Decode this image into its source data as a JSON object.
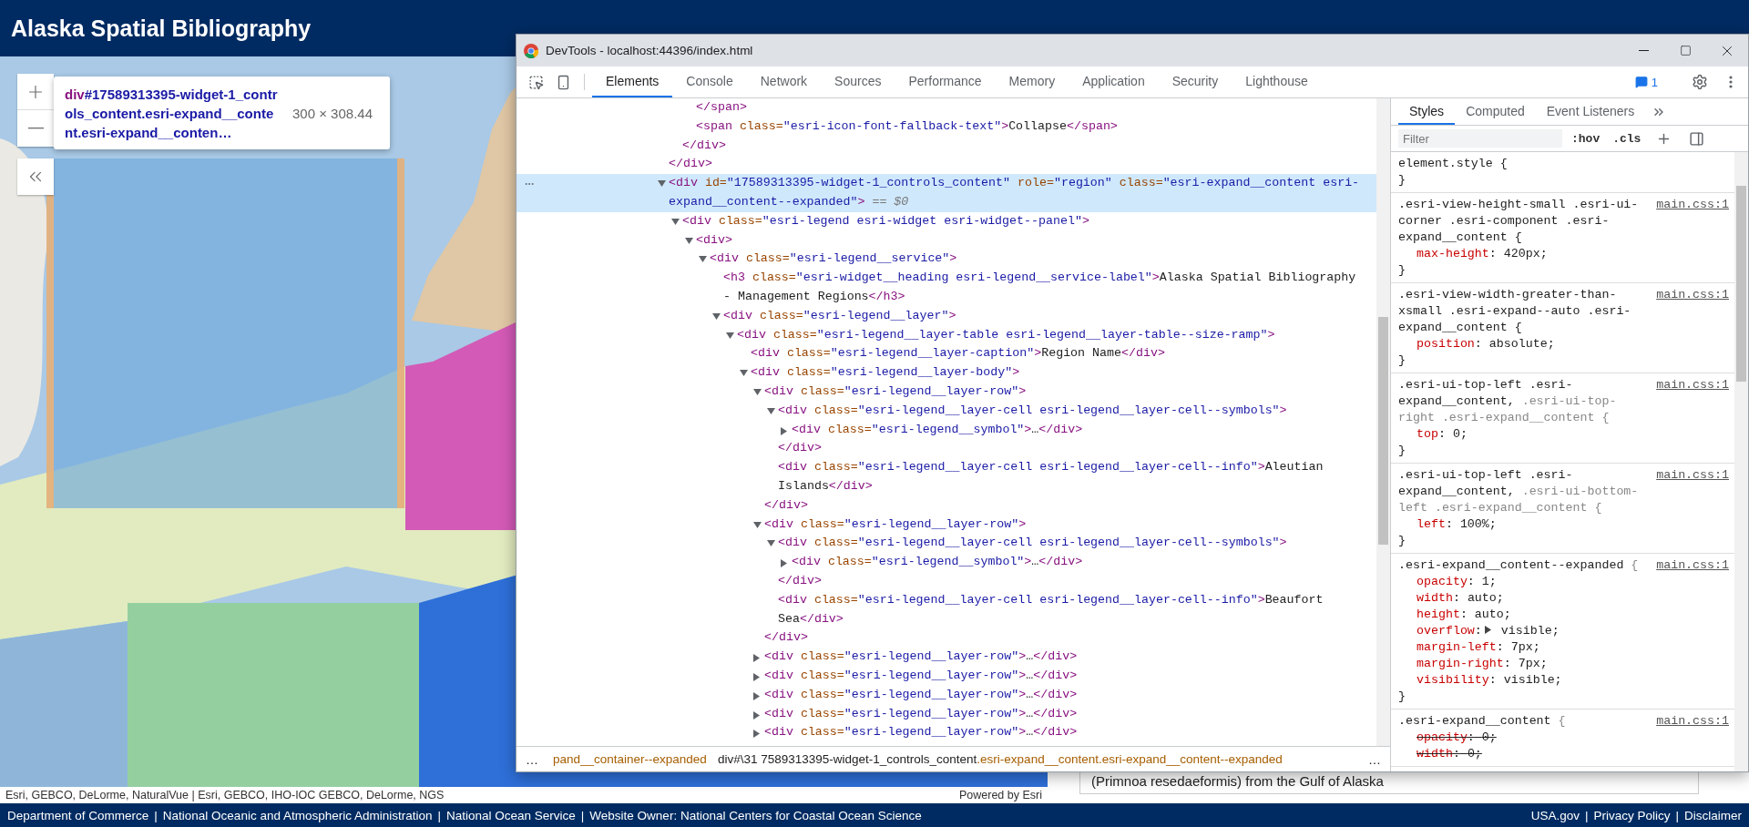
{
  "header": {
    "title": "Alaska Spatial Bibliography"
  },
  "map": {
    "inspect_tooltip": {
      "tag": "div",
      "selector": "#17589313395-widget-1_controls_content.esri-expand__content.esri-expand__conten…",
      "size": "300 × 308.44"
    },
    "attribution": "Esri, GEBCO, DeLorme, NaturalVue | Esri, GEBCO, IHO-IOC GEBCO, DeLorme, NGS",
    "powered_by": "Powered by Esri"
  },
  "sidebar": {
    "result_text": "(Primnoa resedaeformis) from the Gulf of Alaska"
  },
  "devtools": {
    "title": "DevTools - localhost:44396/index.html",
    "tabs": [
      {
        "label": "Elements",
        "selected": true
      },
      {
        "label": "Console",
        "selected": false
      },
      {
        "label": "Network",
        "selected": false
      },
      {
        "label": "Sources",
        "selected": false
      },
      {
        "label": "Performance",
        "selected": false
      },
      {
        "label": "Memory",
        "selected": false
      },
      {
        "label": "Application",
        "selected": false
      },
      {
        "label": "Security",
        "selected": false
      },
      {
        "label": "Lighthouse",
        "selected": false
      }
    ],
    "issues_count": "1",
    "elements": {
      "tree": [
        {
          "close": [
            {
              "kind": "tag",
              "text": "</div>"
            }
          ],
          "children": [
            {
              "close": [
                {
                  "kind": "tag",
                  "text": "</div>"
                }
              ],
              "children": [
                {
                  "kind": "plain",
                  "selected": false,
                  "tokens": [
                    {
                      "kind": "tag",
                      "text": "</span>"
                    }
                  ]
                },
                {
                  "kind": "plain",
                  "selected": false,
                  "tokens": [
                    {
                      "kind": "tag",
                      "text": "<span"
                    },
                    {
                      "kind": "attr",
                      "text": " class="
                    },
                    {
                      "kind": "value",
                      "text": "\"esri-icon-font-fallback-text\""
                    },
                    {
                      "kind": "tag",
                      "text": ">"
                    },
                    {
                      "kind": "text",
                      "text": "Collapse"
                    },
                    {
                      "kind": "tag",
                      "text": "</span>"
                    }
                  ]
                }
              ]
            }
          ]
        },
        {
          "kind": "expanded",
          "selected": true,
          "tokens": [
            {
              "kind": "tag",
              "text": "<div"
            },
            {
              "kind": "attr",
              "text": " id="
            },
            {
              "kind": "value",
              "text": "\"17589313395-widget-1_controls_content\""
            },
            {
              "kind": "attr",
              "text": " role="
            },
            {
              "kind": "value",
              "text": "\"region\""
            },
            {
              "kind": "attr",
              "text": " class="
            },
            {
              "kind": "value",
              "text": "\"esri-expand__content esri-expand__content--expanded\""
            },
            {
              "kind": "tag",
              "text": ">"
            },
            {
              "kind": "note",
              "text": " == $0"
            }
          ],
          "children": [
            {
              "kind": "expanded",
              "selected": false,
              "tokens": [
                {
                  "kind": "tag",
                  "text": "<div"
                },
                {
                  "kind": "attr",
                  "text": " class="
                },
                {
                  "kind": "value",
                  "text": "\"esri-legend esri-widget esri-widget--panel\""
                },
                {
                  "kind": "tag",
                  "text": ">"
                }
              ],
              "children": [
                {
                  "kind": "expanded",
                  "selected": false,
                  "tokens": [
                    {
                      "kind": "tag",
                      "text": "<div>"
                    }
                  ],
                  "children": [
                    {
                      "kind": "expanded",
                      "selected": false,
                      "tokens": [
                        {
                          "kind": "tag",
                          "text": "<div"
                        },
                        {
                          "kind": "attr",
                          "text": " class="
                        },
                        {
                          "kind": "value",
                          "text": "\"esri-legend__service\""
                        },
                        {
                          "kind": "tag",
                          "text": ">"
                        }
                      ],
                      "children": [
                        {
                          "kind": "plain",
                          "selected": false,
                          "tokens": [
                            {
                              "kind": "tag",
                              "text": "<h3"
                            },
                            {
                              "kind": "attr",
                              "text": " class="
                            },
                            {
                              "kind": "value",
                              "text": "\"esri-widget__heading esri-legend__service-label\""
                            },
                            {
                              "kind": "tag",
                              "text": ">"
                            },
                            {
                              "kind": "text",
                              "text": "Alaska Spatial Bibliography - Management Regions"
                            },
                            {
                              "kind": "tag",
                              "text": "</h3>"
                            }
                          ]
                        },
                        {
                          "kind": "expanded",
                          "selected": false,
                          "tokens": [
                            {
                              "kind": "tag",
                              "text": "<div"
                            },
                            {
                              "kind": "attr",
                              "text": " class="
                            },
                            {
                              "kind": "value",
                              "text": "\"esri-legend__layer\""
                            },
                            {
                              "kind": "tag",
                              "text": ">"
                            }
                          ],
                          "children": [
                            {
                              "kind": "expanded",
                              "selected": false,
                              "tokens": [
                                {
                                  "kind": "tag",
                                  "text": "<div"
                                },
                                {
                                  "kind": "attr",
                                  "text": " class="
                                },
                                {
                                  "kind": "value",
                                  "text": "\"esri-legend__layer-table esri-legend__layer-table--size-ramp\""
                                },
                                {
                                  "kind": "tag",
                                  "text": ">"
                                }
                              ],
                              "children": [
                                {
                                  "kind": "plain",
                                  "selected": false,
                                  "tokens": [
                                    {
                                      "kind": "tag",
                                      "text": "<div"
                                    },
                                    {
                                      "kind": "attr",
                                      "text": " class="
                                    },
                                    {
                                      "kind": "value",
                                      "text": "\"esri-legend__layer-caption\""
                                    },
                                    {
                                      "kind": "tag",
                                      "text": ">"
                                    },
                                    {
                                      "kind": "text",
                                      "text": "Region Name"
                                    },
                                    {
                                      "kind": "tag",
                                      "text": "</div>"
                                    }
                                  ]
                                },
                                {
                                  "kind": "expanded",
                                  "selected": false,
                                  "tokens": [
                                    {
                                      "kind": "tag",
                                      "text": "<div"
                                    },
                                    {
                                      "kind": "attr",
                                      "text": " class="
                                    },
                                    {
                                      "kind": "value",
                                      "text": "\"esri-legend__layer-body\""
                                    },
                                    {
                                      "kind": "tag",
                                      "text": ">"
                                    }
                                  ],
                                  "children": [
                                    {
                                      "kind": "expanded",
                                      "selected": false,
                                      "tokens": [
                                        {
                                          "kind": "tag",
                                          "text": "<div"
                                        },
                                        {
                                          "kind": "attr",
                                          "text": " class="
                                        },
                                        {
                                          "kind": "value",
                                          "text": "\"esri-legend__layer-row\""
                                        },
                                        {
                                          "kind": "tag",
                                          "text": ">"
                                        }
                                      ],
                                      "close": [
                                        {
                                          "kind": "tag",
                                          "text": "</div>"
                                        }
                                      ],
                                      "children": [
                                        {
                                          "kind": "expanded",
                                          "selected": false,
                                          "tokens": [
                                            {
                                              "kind": "tag",
                                              "text": "<div"
                                            },
                                            {
                                              "kind": "attr",
                                              "text": " class="
                                            },
                                            {
                                              "kind": "value",
                                              "text": "\"esri-legend__layer-cell esri-legend__layer-cell--symbols\""
                                            },
                                            {
                                              "kind": "tag",
                                              "text": ">"
                                            }
                                          ],
                                          "close": [
                                            {
                                              "kind": "tag",
                                              "text": "</div>"
                                            }
                                          ],
                                          "children": [
                                            {
                                              "kind": "collapsed",
                                              "selected": false,
                                              "tokens": [
                                                {
                                                  "kind": "tag",
                                                  "text": "<div"
                                                },
                                                {
                                                  "kind": "attr",
                                                  "text": " class="
                                                },
                                                {
                                                  "kind": "value",
                                                  "text": "\"esri-legend__symbol\""
                                                },
                                                {
                                                  "kind": "tag",
                                                  "text": ">"
                                                },
                                                {
                                                  "kind": "text",
                                                  "text": "…"
                                                },
                                                {
                                                  "kind": "tag",
                                                  "text": "</div>"
                                                }
                                              ]
                                            }
                                          ]
                                        },
                                        {
                                          "kind": "plain",
                                          "selected": false,
                                          "tokens": [
                                            {
                                              "kind": "tag",
                                              "text": "<div"
                                            },
                                            {
                                              "kind": "attr",
                                              "text": " class="
                                            },
                                            {
                                              "kind": "value",
                                              "text": "\"esri-legend__layer-cell esri-legend__layer-cell--info\""
                                            },
                                            {
                                              "kind": "tag",
                                              "text": ">"
                                            },
                                            {
                                              "kind": "text",
                                              "text": "Aleutian Islands"
                                            },
                                            {
                                              "kind": "tag",
                                              "text": "</div>"
                                            }
                                          ]
                                        }
                                      ]
                                    },
                                    {
                                      "kind": "expanded",
                                      "selected": false,
                                      "tokens": [
                                        {
                                          "kind": "tag",
                                          "text": "<div"
                                        },
                                        {
                                          "kind": "attr",
                                          "text": " class="
                                        },
                                        {
                                          "kind": "value",
                                          "text": "\"esri-legend__layer-row\""
                                        },
                                        {
                                          "kind": "tag",
                                          "text": ">"
                                        }
                                      ],
                                      "close": [
                                        {
                                          "kind": "tag",
                                          "text": "</div>"
                                        }
                                      ],
                                      "children": [
                                        {
                                          "kind": "expanded",
                                          "selected": false,
                                          "tokens": [
                                            {
                                              "kind": "tag",
                                              "text": "<div"
                                            },
                                            {
                                              "kind": "attr",
                                              "text": " class="
                                            },
                                            {
                                              "kind": "value",
                                              "text": "\"esri-legend__layer-cell esri-legend__layer-cell--symbols\""
                                            },
                                            {
                                              "kind": "tag",
                                              "text": ">"
                                            }
                                          ],
                                          "close": [
                                            {
                                              "kind": "tag",
                                              "text": "</div>"
                                            }
                                          ],
                                          "children": [
                                            {
                                              "kind": "collapsed",
                                              "selected": false,
                                              "tokens": [
                                                {
                                                  "kind": "tag",
                                                  "text": "<div"
                                                },
                                                {
                                                  "kind": "attr",
                                                  "text": " class="
                                                },
                                                {
                                                  "kind": "value",
                                                  "text": "\"esri-legend__symbol\""
                                                },
                                                {
                                                  "kind": "tag",
                                                  "text": ">"
                                                },
                                                {
                                                  "kind": "text",
                                                  "text": "…"
                                                },
                                                {
                                                  "kind": "tag",
                                                  "text": "</div>"
                                                }
                                              ]
                                            }
                                          ]
                                        },
                                        {
                                          "kind": "plain",
                                          "selected": false,
                                          "tokens": [
                                            {
                                              "kind": "tag",
                                              "text": "<div"
                                            },
                                            {
                                              "kind": "attr",
                                              "text": " class="
                                            },
                                            {
                                              "kind": "value",
                                              "text": "\"esri-legend__layer-cell esri-legend__layer-cell--info\""
                                            },
                                            {
                                              "kind": "tag",
                                              "text": ">"
                                            },
                                            {
                                              "kind": "text",
                                              "text": "Beaufort Sea"
                                            },
                                            {
                                              "kind": "tag",
                                              "text": "</div>"
                                            }
                                          ]
                                        }
                                      ]
                                    },
                                    {
                                      "kind": "collapsed",
                                      "selected": false,
                                      "tokens": [
                                        {
                                          "kind": "tag",
                                          "text": "<div"
                                        },
                                        {
                                          "kind": "attr",
                                          "text": " class="
                                        },
                                        {
                                          "kind": "value",
                                          "text": "\"esri-legend__layer-row\""
                                        },
                                        {
                                          "kind": "tag",
                                          "text": ">"
                                        },
                                        {
                                          "kind": "text",
                                          "text": "…"
                                        },
                                        {
                                          "kind": "tag",
                                          "text": "</div>"
                                        }
                                      ]
                                    },
                                    {
                                      "kind": "collapsed",
                                      "selected": false,
                                      "tokens": [
                                        {
                                          "kind": "tag",
                                          "text": "<div"
                                        },
                                        {
                                          "kind": "attr",
                                          "text": " class="
                                        },
                                        {
                                          "kind": "value",
                                          "text": "\"esri-legend__layer-row\""
                                        },
                                        {
                                          "kind": "tag",
                                          "text": ">"
                                        },
                                        {
                                          "kind": "text",
                                          "text": "…"
                                        },
                                        {
                                          "kind": "tag",
                                          "text": "</div>"
                                        }
                                      ]
                                    },
                                    {
                                      "kind": "collapsed",
                                      "selected": false,
                                      "tokens": [
                                        {
                                          "kind": "tag",
                                          "text": "<div"
                                        },
                                        {
                                          "kind": "attr",
                                          "text": " class="
                                        },
                                        {
                                          "kind": "value",
                                          "text": "\"esri-legend__layer-row\""
                                        },
                                        {
                                          "kind": "tag",
                                          "text": ">"
                                        },
                                        {
                                          "kind": "text",
                                          "text": "…"
                                        },
                                        {
                                          "kind": "tag",
                                          "text": "</div>"
                                        }
                                      ]
                                    },
                                    {
                                      "kind": "collapsed",
                                      "selected": false,
                                      "tokens": [
                                        {
                                          "kind": "tag",
                                          "text": "<div"
                                        },
                                        {
                                          "kind": "attr",
                                          "text": " class="
                                        },
                                        {
                                          "kind": "value",
                                          "text": "\"esri-legend__layer-row\""
                                        },
                                        {
                                          "kind": "tag",
                                          "text": ">"
                                        },
                                        {
                                          "kind": "text",
                                          "text": "…"
                                        },
                                        {
                                          "kind": "tag",
                                          "text": "</div>"
                                        }
                                      ]
                                    },
                                    {
                                      "kind": "collapsed",
                                      "selected": false,
                                      "tokens": [
                                        {
                                          "kind": "tag",
                                          "text": "<div"
                                        },
                                        {
                                          "kind": "attr",
                                          "text": " class="
                                        },
                                        {
                                          "kind": "value",
                                          "text": "\"esri-legend__layer-row\""
                                        },
                                        {
                                          "kind": "tag",
                                          "text": ">"
                                        },
                                        {
                                          "kind": "text",
                                          "text": "…"
                                        },
                                        {
                                          "kind": "tag",
                                          "text": "</div>"
                                        }
                                      ]
                                    }
                                  ]
                                }
                              ]
                            }
                          ]
                        }
                      ]
                    }
                  ]
                }
              ]
            }
          ]
        }
      ],
      "breadcrumbs": {
        "overflow_left": "…",
        "overflow_right": "…",
        "items": [
          {
            "classes": "pand__container--expanded"
          },
          {
            "name": "div#\\31 7589313395-widget-1_controls_content",
            "classes": ".esri-expand__content.esri-expand__content--expanded"
          }
        ]
      }
    },
    "styles": {
      "tabs": [
        {
          "label": "Styles",
          "selected": true
        },
        {
          "label": "Computed",
          "selected": false
        },
        {
          "label": "Event Listeners",
          "selected": false
        }
      ],
      "filter": {
        "placeholder": "Filter"
      },
      "toggles": [
        ":hov",
        ".cls"
      ],
      "rules": [
        {
          "selector": [
            {
              "text": "element.style",
              "dim": false
            },
            {
              "text": " {",
              "dim": false
            }
          ],
          "close": "}"
        },
        {
          "selector": [
            {
              "text": ".esri-view-height-small .esri-ui-corner .esri-component .esri-expand__content",
              "dim": false
            },
            {
              "text": " {",
              "dim": false
            }
          ],
          "source": "main.css:1",
          "close": "}",
          "declarations": [
            {
              "property": "max-height",
              "colon": ":",
              "value": "420px;",
              "struck": false,
              "expandable": false
            }
          ]
        },
        {
          "selector": [
            {
              "text": ".esri-view-width-greater-than-xsmall .esri-expand--auto .esri-expand__content",
              "dim": false
            },
            {
              "text": " {",
              "dim": false
            }
          ],
          "source": "main.css:1",
          "close": "}",
          "declarations": [
            {
              "property": "position",
              "colon": ":",
              "value": "absolute;",
              "struck": false,
              "expandable": false
            }
          ]
        },
        {
          "selector": [
            {
              "text": ".esri-ui-top-left .esri-expand__content,",
              "dim": false
            },
            {
              "text": " .esri-ui-top-right .esri-expand__content {",
              "dim": true
            }
          ],
          "source": "main.css:1",
          "close": "}",
          "declarations": [
            {
              "property": "top",
              "colon": ":",
              "value": "0;",
              "struck": false,
              "expandable": false
            }
          ]
        },
        {
          "selector": [
            {
              "text": ".esri-ui-top-left .esri-expand__content,",
              "dim": false
            },
            {
              "text": " .esri-ui-bottom-left .esri-expand__content {",
              "dim": true
            }
          ],
          "source": "main.css:1",
          "close": "}",
          "declarations": [
            {
              "property": "left",
              "colon": ":",
              "value": "100%;",
              "struck": false,
              "expandable": false
            }
          ]
        },
        {
          "selector": [
            {
              "text": ".esri-expand__content--expanded",
              "dim": false
            },
            {
              "text": " {",
              "dim": true
            }
          ],
          "source": "main.css:1",
          "close": "}",
          "declarations": [
            {
              "property": "opacity",
              "colon": ":",
              "value": "1;",
              "struck": false,
              "expandable": false
            },
            {
              "property": "width",
              "colon": ":",
              "value": "auto;",
              "struck": false,
              "expandable": false
            },
            {
              "property": "height",
              "colon": ":",
              "value": "auto;",
              "struck": false,
              "expandable": false
            },
            {
              "property": "overflow",
              "colon": ":",
              "value": "visible;",
              "struck": false,
              "expandable": true
            },
            {
              "property": "margin-left",
              "colon": ":",
              "value": "7px;",
              "struck": false,
              "expandable": false
            },
            {
              "property": "margin-right",
              "colon": ":",
              "value": "7px;",
              "struck": false,
              "expandable": false
            },
            {
              "property": "visibility",
              "colon": ":",
              "value": "visible;",
              "struck": false,
              "expandable": false
            }
          ]
        },
        {
          "selector": [
            {
              "text": ".esri-expand__content",
              "dim": false
            },
            {
              "text": " {",
              "dim": true
            }
          ],
          "source": "main.css:1",
          "declarations": [
            {
              "property": "opacity",
              "colon": ":",
              "value": "0;",
              "struck": true,
              "expandable": false
            },
            {
              "property": "width",
              "colon": ":",
              "value": "0;",
              "struck": true,
              "expandable": false
            }
          ]
        }
      ]
    }
  },
  "footer": {
    "separator": "|",
    "left_links": [
      "Department of Commerce",
      "National Oceanic and Atmospheric Administration",
      "National Ocean Service",
      "Website Owner: National Centers for Coastal Ocean Science"
    ],
    "right_links": [
      "USA.gov",
      "Privacy Policy",
      "Disclaimer"
    ]
  }
}
